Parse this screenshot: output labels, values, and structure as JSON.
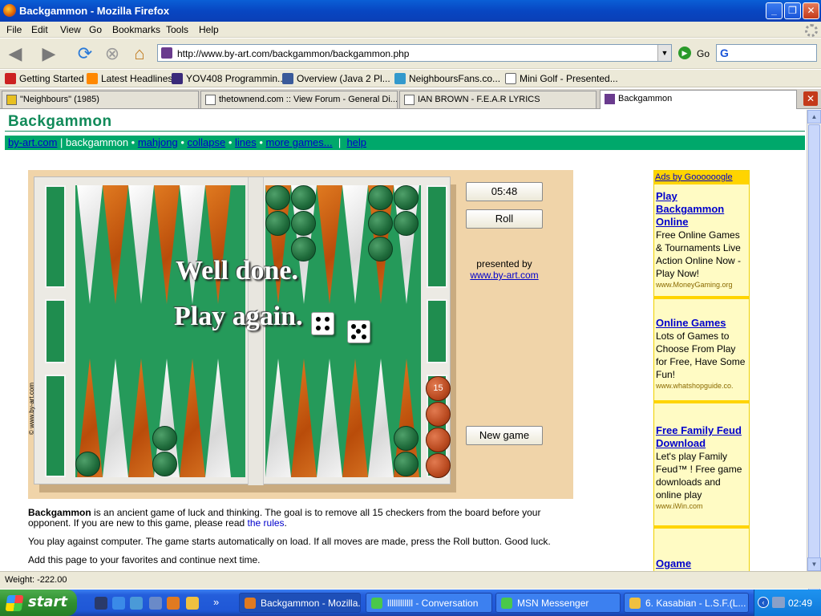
{
  "window": {
    "title": "Backgammon - Mozilla Firefox"
  },
  "menu": [
    "File",
    "Edit",
    "View",
    "Go",
    "Bookmarks",
    "Tools",
    "Help"
  ],
  "nav": {
    "url": "http://www.by-art.com/backgammon/backgammon.php",
    "go_label": "Go"
  },
  "bookmarks": [
    "Getting Started",
    "Latest Headlines",
    "YOV408 Programmin...",
    "Overview (Java 2 Pl...",
    "NeighboursFans.co...",
    "Mini Golf - Presented..."
  ],
  "tabs": [
    "\"Neighbours\" (1985)",
    "thetownend.com :: View Forum - General Di...",
    "IAN BROWN - F.E.A.R LYRICS",
    "Backgammon"
  ],
  "page": {
    "title": "Backgammon",
    "nav": {
      "by_art": "by-art.com",
      "sep1": " | ",
      "current": "backgammon",
      "dot": " • ",
      "mahjong": "mahjong",
      "collapse": "collapse",
      "lines": "lines",
      "more": "more games...",
      "sep2": "  |  ",
      "help": "help"
    },
    "game": {
      "timer": "05:48",
      "roll": "Roll",
      "presented_by": "presented by",
      "presented_link": "www.by-art.com",
      "new_game": "New game",
      "message_line1": "Well done.",
      "message_line2": "Play again.",
      "stack_count": "15",
      "copyright": "© www.by-art.com",
      "dice": [
        4,
        5
      ]
    },
    "description": {
      "bold": "Backgammon",
      "p1": " is an ancient game of luck and thinking. The goal is to remove all 15 checkers from the board before your opponent. If you are new to this game, please read ",
      "rules_link": "the rules",
      "p1_end": ".",
      "p2": "You play against computer. The game starts automatically on load. If all moves are made, press the Roll button. Good luck.",
      "p3": "Add this page to your favorites and continue next time."
    },
    "ads": {
      "header": "Ads by Goooooogle",
      "items": [
        {
          "title": "Play Backgammon Online",
          "body": "Free Online Games & Tournaments Live Action Online Now - Play Now!",
          "url": "www.MoneyGaming.org"
        },
        {
          "title": "Online Games",
          "body": "Lots of Games to Choose From Play for Free, Have Some Fun!",
          "url": "www.whatshopguide.co."
        },
        {
          "title": "Free Family Feud Download",
          "body": "Let's play Family Feud™ ! Free game downloads and online play",
          "url": "www.iWin.com"
        },
        {
          "title": "Ogame",
          "body": "",
          "url": ""
        }
      ]
    }
  },
  "status": {
    "text": "Weight: -222.00"
  },
  "taskbar": {
    "start": "start",
    "tasks": [
      "Backgammon - Mozilla...",
      "llllllllllll - Conversation",
      "MSN Messenger",
      "6. Kasabian - L.S.F.(L..."
    ],
    "clock": "02:49"
  }
}
